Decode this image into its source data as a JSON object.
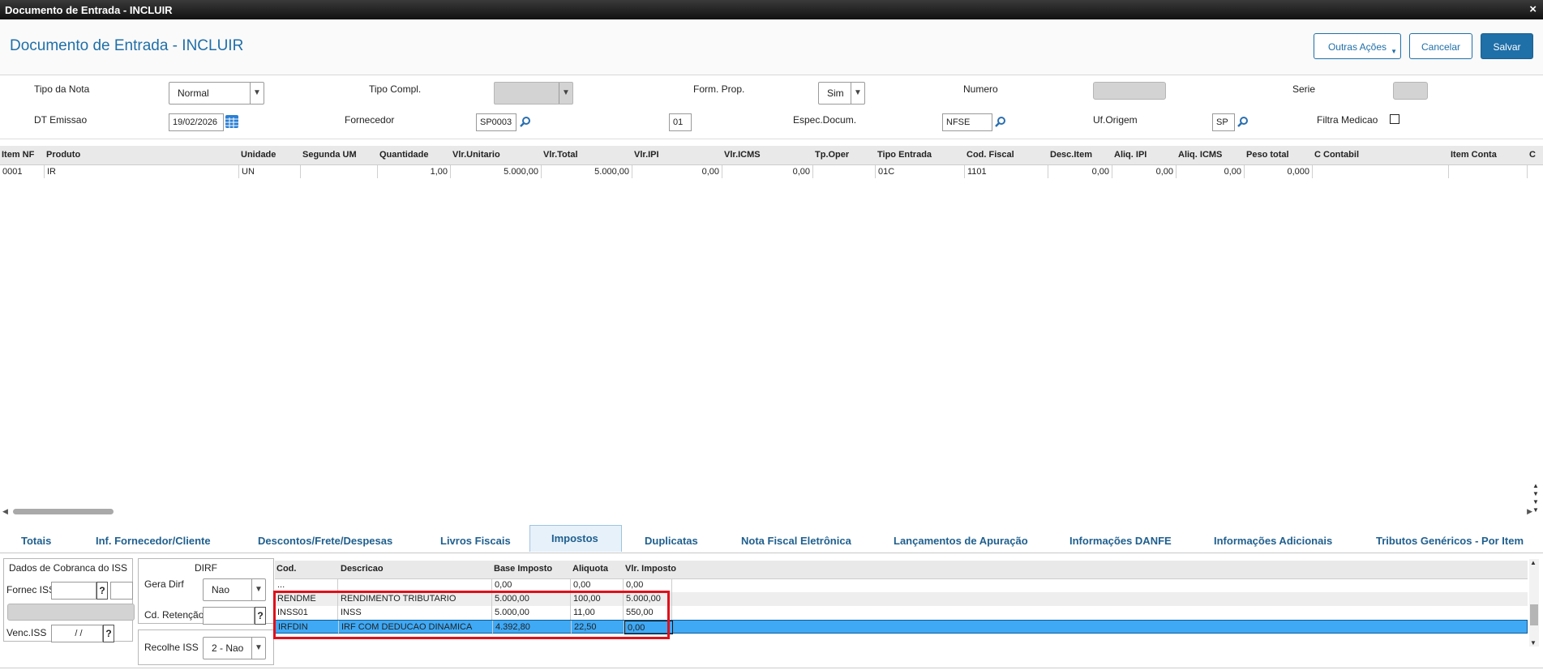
{
  "window": {
    "title": "Documento de Entrada - INCLUIR",
    "close_glyph": "×"
  },
  "header": {
    "title": "Documento de Entrada - INCLUIR",
    "buttons": {
      "other_actions": "Outras Ações",
      "cancel": "Cancelar",
      "save": "Salvar"
    }
  },
  "form": {
    "tipo_nota": {
      "label": "Tipo da Nota",
      "value": "Normal"
    },
    "tipo_compl": {
      "label": "Tipo Compl.",
      "value": ""
    },
    "form_prop": {
      "label": "Form. Prop.",
      "value": "Sim"
    },
    "numero": {
      "label": "Numero",
      "value": ""
    },
    "serie": {
      "label": "Serie",
      "value": ""
    },
    "dt_emissao": {
      "label": "DT Emissao",
      "value": "19/02/2026"
    },
    "fornecedor": {
      "label": "Fornecedor",
      "value": "SP0003",
      "loja": "01"
    },
    "espec_docum": {
      "label": "Espec.Docum.",
      "value": "NFSE"
    },
    "uf_origem": {
      "label": "Uf.Origem",
      "value": "SP"
    },
    "filtra_medicao": {
      "label": "Filtra Medicao",
      "checked": false
    }
  },
  "items_grid": {
    "columns": [
      "Item NF",
      "Produto",
      "Unidade",
      "Segunda UM",
      "Quantidade",
      "Vlr.Unitario",
      "Vlr.Total",
      "Vlr.IPI",
      "Vlr.ICMS",
      "Tp.Oper",
      "Tipo Entrada",
      "Cod. Fiscal",
      "Desc.Item",
      "Aliq. IPI",
      "Aliq. ICMS",
      "Peso total",
      "C Contabil",
      "Item Conta",
      "C"
    ],
    "rows": [
      [
        "0001",
        "IR",
        "UN",
        "",
        "1,00",
        "5.000,00",
        "5.000,00",
        "0,00",
        "0,00",
        "",
        "01C",
        "1101",
        "0,00",
        "0,00",
        "0,00",
        "0,000",
        "",
        ""
      ]
    ]
  },
  "tabs": [
    "Totais",
    "Inf. Fornecedor/Cliente",
    "Descontos/Frete/Despesas",
    "Livros Fiscais",
    "Impostos",
    "Duplicatas",
    "Nota Fiscal Eletrônica",
    "Lançamentos de Apuração",
    "Informações DANFE",
    "Informações Adicionais",
    "Tributos Genéricos - Por Item"
  ],
  "iss_panel": {
    "title": "Dados de Cobranca do ISS",
    "fornec_iss_label": "Fornec ISS",
    "venc_iss_label": "Venc.ISS",
    "venc_iss_value": " /  /",
    "help": "?"
  },
  "dirf_panel": {
    "title": "DIRF",
    "gera_dirf_label": "Gera Dirf",
    "gera_dirf_value": "Nao",
    "cd_retencao_label": "Cd. Retenção",
    "help": "?"
  },
  "recolhe_iss": {
    "label": "Recolhe ISS",
    "value": "2 - Nao"
  },
  "taxes_table": {
    "columns": [
      "Cod.",
      "Descricao",
      "Base Imposto",
      "Aliquota",
      "Vlr. Imposto"
    ],
    "rows": [
      [
        "...",
        "",
        "0,00",
        "0,00",
        "0,00"
      ],
      [
        "RENDME",
        "RENDIMENTO TRIBUTARIO",
        "5.000,00",
        "100,00",
        "5.000,00"
      ],
      [
        "INSS01",
        "INSS",
        "5.000,00",
        "11,00",
        "550,00"
      ],
      [
        "IRFDIN",
        "IRF COM DEDUCAO DINAMICA",
        "4.392,80",
        "22,50",
        "0,00"
      ]
    ],
    "selected_row": 3,
    "highlight_color": "#e0101a",
    "selection_color": "#3fa9f5"
  },
  "colors": {
    "accent": "#1f6fa8"
  }
}
